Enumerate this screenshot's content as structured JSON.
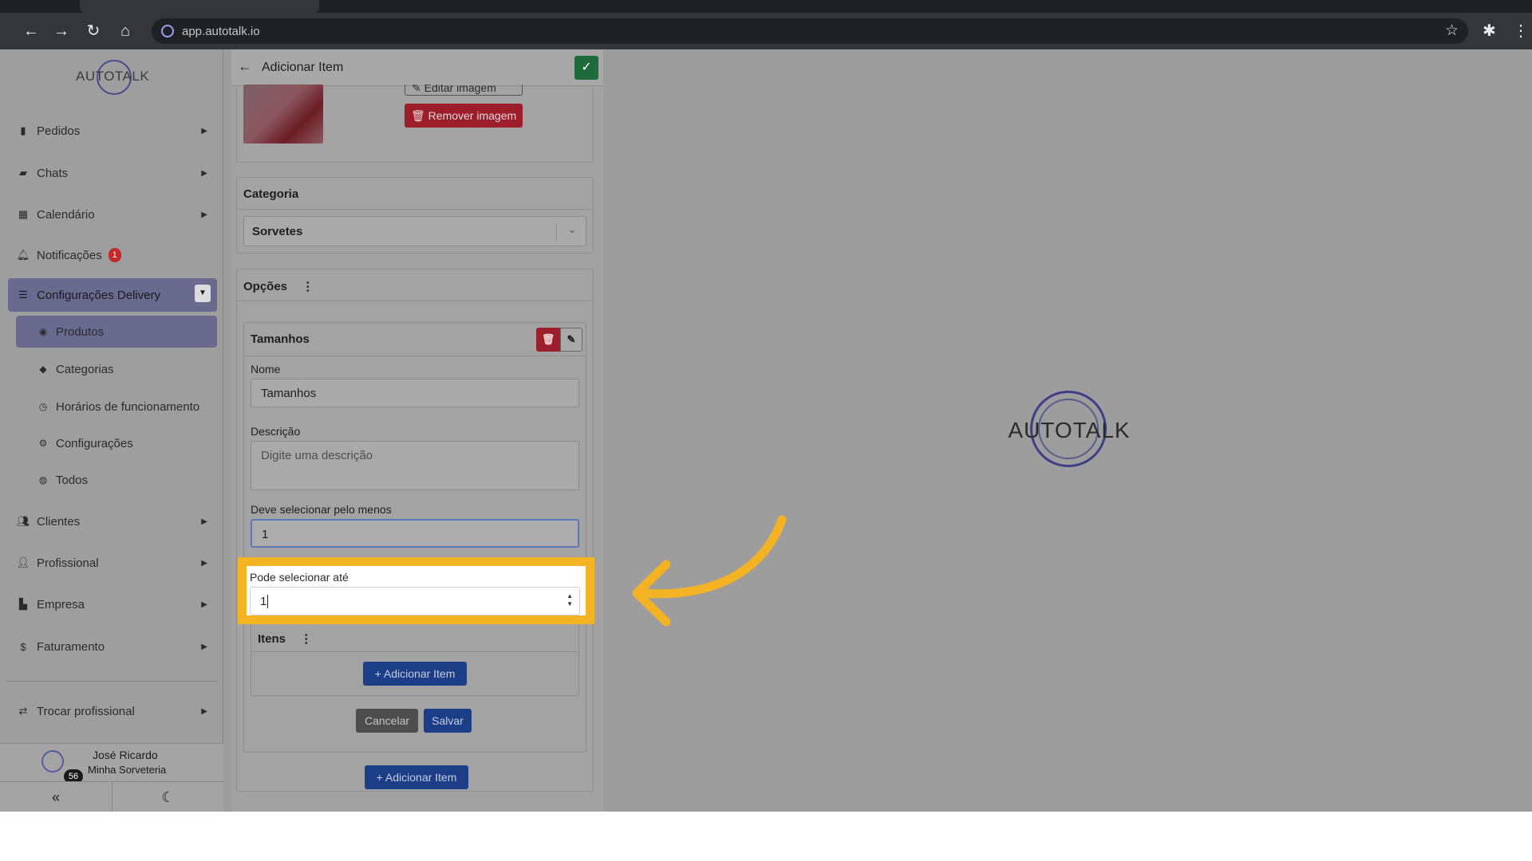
{
  "browser": {
    "url": "app.autotalk.io"
  },
  "sidebar": {
    "logo_text": "AUTOTALK",
    "items": [
      {
        "label": "Pedidos",
        "icon": "clipboard-icon"
      },
      {
        "label": "Chats",
        "icon": "chat-icon"
      },
      {
        "label": "Calendário",
        "icon": "calendar-icon"
      },
      {
        "label": "Notificações",
        "icon": "bell-icon",
        "badge": "1"
      },
      {
        "label": "Configurações Delivery",
        "icon": "sliders-icon"
      }
    ],
    "sub_items": [
      {
        "label": "Produtos",
        "icon": "tag-icon"
      },
      {
        "label": "Categorias",
        "icon": "tag-icon"
      },
      {
        "label": "Horários de funcionamento",
        "icon": "clock-icon"
      },
      {
        "label": "Configurações",
        "icon": "gear-icon"
      },
      {
        "label": "Todos",
        "icon": "globe-icon"
      }
    ],
    "items_lower": [
      {
        "label": "Clientes",
        "icon": "users-icon"
      },
      {
        "label": "Profissional",
        "icon": "user-tie-icon"
      },
      {
        "label": "Empresa",
        "icon": "building-icon"
      },
      {
        "label": "Faturamento",
        "icon": "dollar-icon"
      }
    ],
    "switch_label": "Trocar profissional",
    "user": {
      "name": "José Ricardo",
      "store": "Minha Sorveteria",
      "count": "56"
    }
  },
  "panel": {
    "title": "Adicionar Item",
    "edit_image_label": "Editar imagem",
    "remove_image_label": "Remover imagem",
    "category_header": "Categoria",
    "category_value": "Sorvetes",
    "options_header": "Opções",
    "option_group": {
      "title": "Tamanhos",
      "name_label": "Nome",
      "name_value": "Tamanhos",
      "description_label": "Descrição",
      "description_placeholder": "Digite uma descrição",
      "min_label": "Deve selecionar pelo menos",
      "min_value": "1",
      "max_label": "Pode selecionar até",
      "max_value": "1",
      "items_header": "Itens",
      "add_item_label": "+ Adicionar Item",
      "cancel_label": "Cancelar",
      "save_label": "Salvar"
    },
    "add_item_label": "+ Adicionar Item"
  },
  "main": {
    "logo_text": "AUTOTALK"
  },
  "colors": {
    "highlight": "#f4b323",
    "accent_blue": "#1b3e87",
    "danger": "#9c1e2a",
    "success": "#1d6b3a"
  }
}
